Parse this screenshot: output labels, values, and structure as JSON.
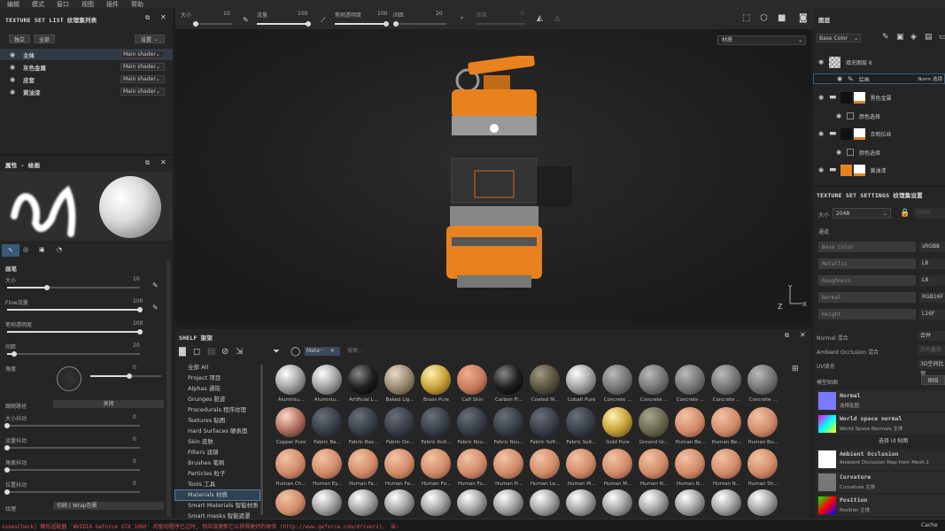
{
  "menu": [
    "编辑",
    "模式",
    "窗口",
    "视图",
    "插件",
    "帮助"
  ],
  "toolbar": {
    "size_label": "大小",
    "size_value": "10",
    "flow_label": "流量",
    "flow_value": "100",
    "opacity_label": "笔刷透明度",
    "opacity_value": "100",
    "spacing_label": "间距",
    "spacing_value": "20",
    "distance_label": "距离",
    "distance_value": "0"
  },
  "texset_list": {
    "title": "TEXTURE SET LIST 纹理集列表",
    "btn_solo": "独立",
    "btn_all": "全部",
    "btn_settings": "设置",
    "items": [
      {
        "name": "主体",
        "shader": "Main shader"
      },
      {
        "name": "灰色金属",
        "shader": "Main shader"
      },
      {
        "name": "皮套",
        "shader": "Main shader"
      },
      {
        "name": "黄油漆",
        "shader": "Main shader"
      }
    ]
  },
  "properties": {
    "title": "属性 - 绘画",
    "section": "画笔",
    "size_label": "大小",
    "size_value": "10",
    "flow_label": "Flow流量",
    "flow_value": "100",
    "opacity_label": "笔刷透明度",
    "opacity_value": "100",
    "spacing_label": "间距",
    "spacing_value": "20",
    "angle_label": "角度",
    "angle_value": "0",
    "follow_label": "跟随路径",
    "follow_value": "关闭",
    "size_jitter_label": "大小抖动",
    "size_jitter_value": "0",
    "flow_jitter_label": "流量抖动",
    "flow_jitter_value": "0",
    "angle_jitter_label": "角度抖动",
    "angle_jitter_value": "0",
    "pos_jitter_label": "位置抖动",
    "pos_jitter_value": "0",
    "texture_label": "纹理",
    "texture_value": "切线 | Wrap包裹"
  },
  "viewport": {
    "mode_select": "材质"
  },
  "shelf": {
    "title": "SHELF 架架",
    "filter_tag": "Mate···",
    "search_placeholder": "搜索...",
    "categories": [
      "全部 All",
      "Project 项目",
      "Alphas 通陆",
      "Grunges 脏迹",
      "Procedurals 程序纹理",
      "Textures 贴图",
      "Hard Surfaces 硬表面",
      "Skin 皮肤",
      "Filters 滤镜",
      "Brushes 笔刷",
      "Particles 粒子",
      "Tools 工具",
      "Materials 材质",
      "Smart Materials 智能材质",
      "Smart masks 智能遮罩"
    ],
    "selected_category": "Materials 材质",
    "materials_row1": [
      "Aluminiu...",
      "Aluminiu...",
      "Artificial L...",
      "Baked Lig...",
      "Brass Pure",
      "Calf Skin",
      "Carbon Fi...",
      "Coated M...",
      "Cobalt Pure",
      "Concrete ...",
      "Concrete ...",
      "Concrete ...",
      "Concrete ...",
      "Concrete ..."
    ],
    "materials_row2": [
      "Copper Pure",
      "Fabric Ba...",
      "Fabric Bas...",
      "Fabric De...",
      "Fabric Knit...",
      "Fabric Rou...",
      "Fabric Rou...",
      "Fabric Soft...",
      "Fabric Suit...",
      "Gold Pure",
      "Ground Gr...",
      "Human Ba...",
      "Human Be...",
      "Human Bu..."
    ],
    "materials_row3": [
      "Human Ch...",
      "Human Ey...",
      "Human Fa...",
      "Human Fe...",
      "Human Fo...",
      "Human Fo...",
      "Human H...",
      "Human Le...",
      "Human M...",
      "Human M...",
      "Human N...",
      "Human N...",
      "Human N...",
      "Human Sh..."
    ]
  },
  "layers": {
    "title": "图层",
    "channel": "Base Color",
    "items": [
      {
        "name": "填充图层 6",
        "type": "fill"
      },
      {
        "name": "绘画",
        "blend": "Norm 选锁"
      },
      {
        "name": "黑色金属",
        "type": "folder"
      },
      {
        "name": "颜色选择",
        "type": "mask"
      },
      {
        "name": "合明拉丝",
        "type": "folder"
      },
      {
        "name": "颜色选择",
        "type": "mask"
      },
      {
        "name": "黄油漆",
        "type": "folder"
      }
    ]
  },
  "texset_settings": {
    "title": "TEXTURE SET SETTINGS 纹理集设置",
    "size_label": "大小",
    "size_value": "2048",
    "size_value2": "2048",
    "channels_label": "通道",
    "channels": [
      {
        "name": "Base Color",
        "format": "sRGB8"
      },
      {
        "name": "Metallic",
        "format": "L8"
      },
      {
        "name": "Roughness",
        "format": "L8"
      },
      {
        "name": "Normal",
        "format": "RGB16F"
      },
      {
        "name": "Height",
        "format": "L16F"
      }
    ],
    "normal_mix_label": "Normal 混合",
    "normal_mix_value": "合并",
    "ao_mix_label": "Ambient Occlusion 混合",
    "ao_mix_value": "正片叠底",
    "uv_label": "UV填充",
    "uv_value": "3D空间比邻",
    "maps_label": "模型贴图",
    "maps_btn": "烘焙",
    "maps": [
      {
        "name": "Normal",
        "sub": "选择贴图"
      },
      {
        "name": "World space normal",
        "sub": "World Space Normals 主体"
      },
      {
        "name": "选择 id 贴图",
        "sub": ""
      },
      {
        "name": "Ambient Occlusion",
        "sub": "Ambient Occlusion Map from Mesh 2"
      },
      {
        "name": "Curvature",
        "sub": "Curvature 主体"
      },
      {
        "name": "Position",
        "sub": "Position 主体"
      }
    ]
  },
  "status": {
    "log": "ssuesCheck] 图形适配器 'NVIDIA GeForce GTX 1060' 的驱动程序已过时, 你应该更新它以获得更好的体验 (http://www.geforce.com/drivers)。 当~",
    "cache": "Cache"
  },
  "colors": {
    "accent": "#e8821e",
    "bg": "#1e1e1e",
    "panel": "#252525"
  }
}
